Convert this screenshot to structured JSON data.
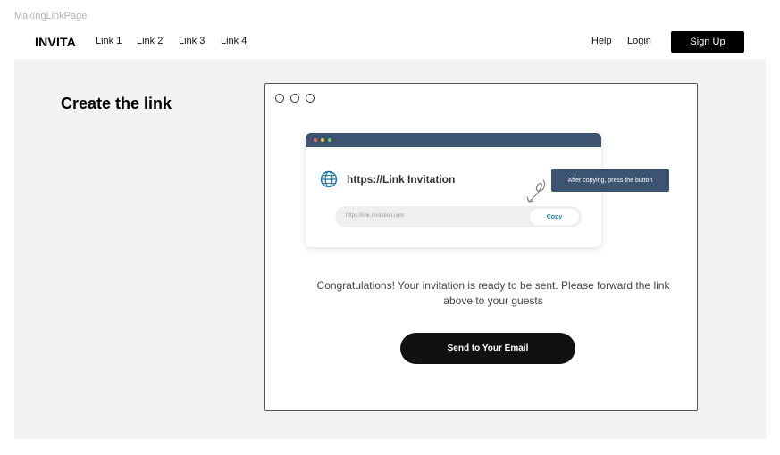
{
  "frame": {
    "label": "MakingLinkPage"
  },
  "header": {
    "brand": "INVITA",
    "nav": [
      "Link 1",
      "Link 2",
      "Link 3",
      "Link 4"
    ],
    "help": "Help",
    "login": "Login",
    "signup": "Sign Up"
  },
  "page": {
    "heading": "Create the link"
  },
  "card": {
    "link_title": "https://Link Invitation",
    "url_value": "https://link.invitation.com",
    "copy_label": "Copy",
    "tooltip": "After copying, press the button",
    "message": "Congratulations! Your invitation is ready to be sent. Please forward the link above to your guests",
    "send_label": "Send to Your Email"
  },
  "colors": {
    "accent": "#3d5372",
    "copy_text": "#1f7aa8",
    "dot_red": "#f76b6b",
    "dot_yellow": "#f2c94c",
    "dot_green": "#6fcf6f"
  },
  "icons": {
    "window_controls": "circle-outline",
    "globe": "globe-icon",
    "arrow": "curved-arrow-icon"
  }
}
